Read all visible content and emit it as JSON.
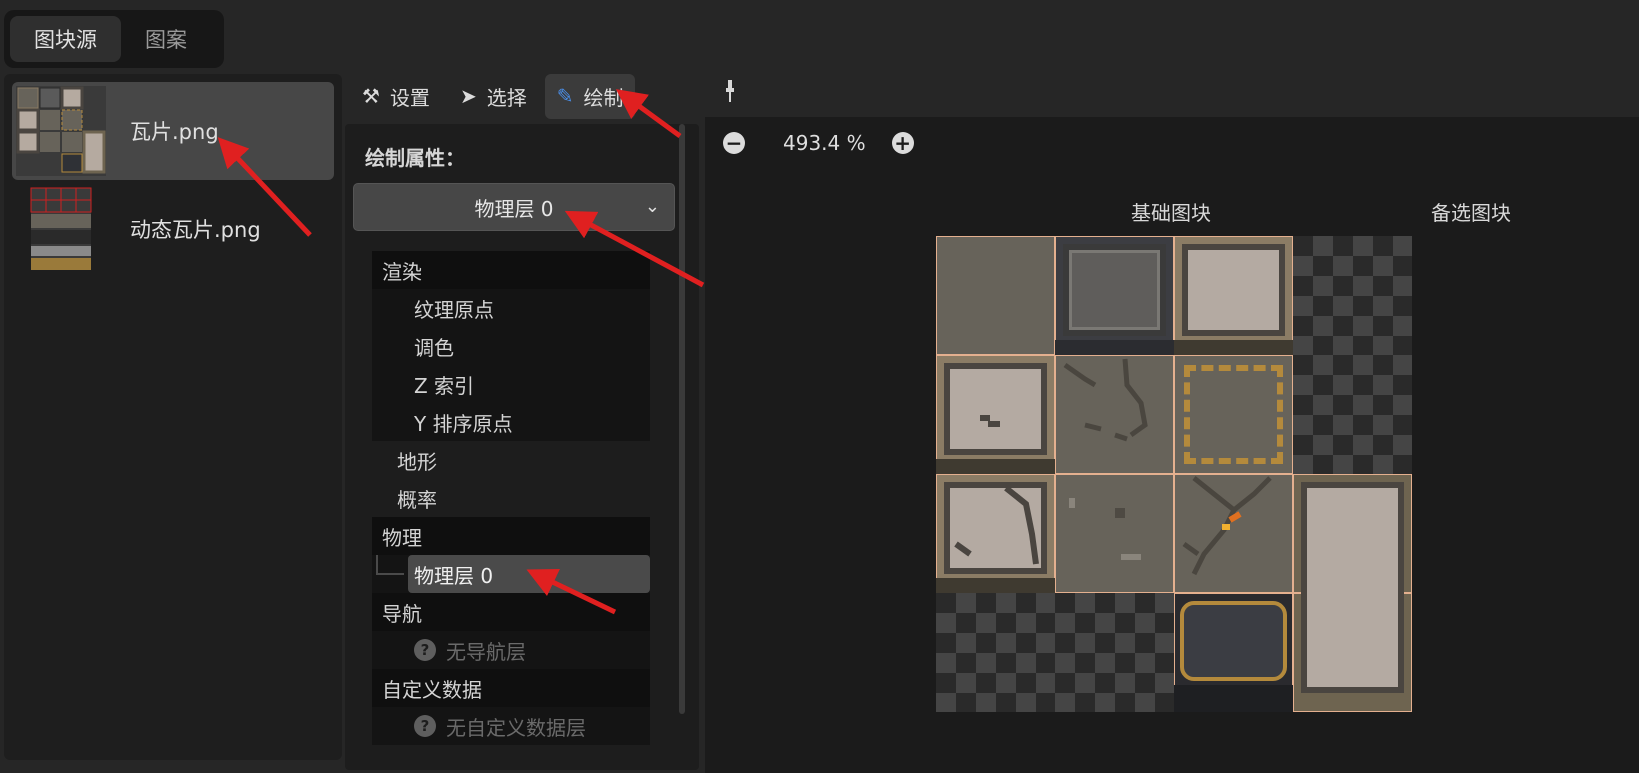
{
  "top_tabs": [
    {
      "label": "图块源",
      "active": true
    },
    {
      "label": "图案",
      "active": false
    }
  ],
  "sources": [
    {
      "name": "瓦片.png",
      "selected": true
    },
    {
      "name": "动态瓦片.png",
      "selected": false
    }
  ],
  "inspector_tabs": [
    {
      "label": "设置",
      "icon": "tools-icon",
      "glyph": "⚒"
    },
    {
      "label": "选择",
      "icon": "cursor-icon",
      "glyph": "➤"
    },
    {
      "label": "绘制",
      "icon": "paintbrush-icon",
      "glyph": "✎",
      "active": true
    }
  ],
  "paint": {
    "title": "绘制属性：",
    "selected_layer": "物理层 0"
  },
  "tree": {
    "render": "渲染",
    "texture_origin": "纹理原点",
    "modulate": "调色",
    "z_index": "Z 索引",
    "y_sort_origin": "Y 排序原点",
    "terrain": "地形",
    "probability": "概率",
    "physics": "物理",
    "physics_layer": "物理层 0",
    "navigation": "导航",
    "no_nav_layer": "无导航层",
    "custom_data": "自定义数据",
    "no_custom_data_layer": "无自定义数据层"
  },
  "canvas": {
    "zoom": "493.4 %",
    "base_tiles_label": "基础图块",
    "alt_tiles_label": "备选图块",
    "eyedropper_icon": "eyedropper-icon"
  },
  "colors": {
    "tile_outline": "#e4b08f",
    "annotation_arrow": "#e02020",
    "selected_tab_bg": "#3b3b3b",
    "brush_accent": "#4a8ee8"
  }
}
